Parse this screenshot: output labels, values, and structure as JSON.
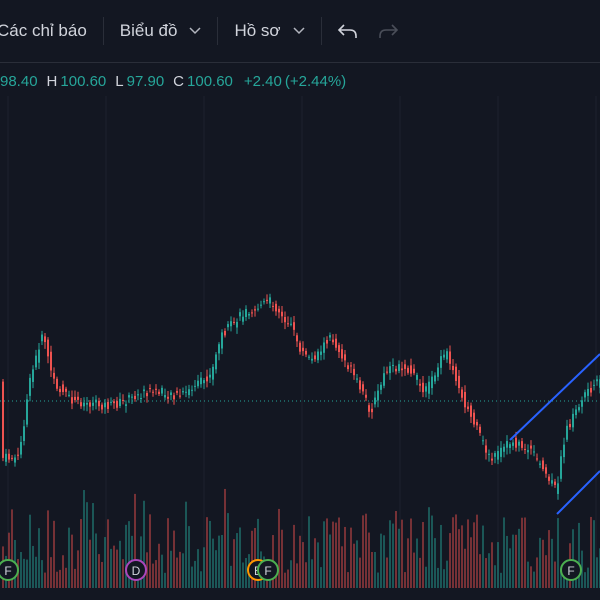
{
  "toolbar": {
    "indicators_label": "Các chỉ báo",
    "chart_label": "Biểu đồ",
    "profile_label": "Hồ sơ",
    "undo_icon": "undo-icon",
    "redo_icon": "redo-icon"
  },
  "ohlc": {
    "open_value": "98.40",
    "high_label": "H",
    "high_value": "100.60",
    "low_label": "L",
    "low_value": "97.90",
    "close_label": "C",
    "close_value": "100.60",
    "change": "+2.40",
    "change_pct": "(+2.44%)"
  },
  "colors": {
    "background": "#131722",
    "up": "#26a69a",
    "down": "#ef5350",
    "trendline": "#2962ff",
    "dividend": "#ab47bc"
  },
  "events": [
    {
      "label": "F",
      "kind": "earnings"
    },
    {
      "label": "D",
      "kind": "dividend"
    },
    {
      "label": "E",
      "kind": "earnings"
    },
    {
      "label": "F",
      "kind": "earnings"
    },
    {
      "label": "F",
      "kind": "earnings"
    }
  ]
}
